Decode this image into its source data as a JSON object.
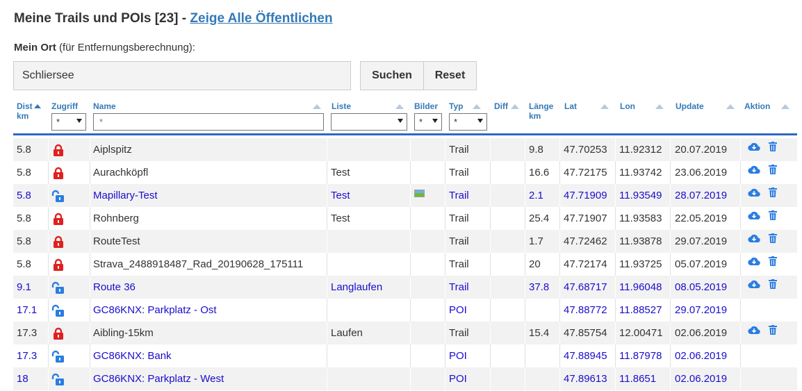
{
  "header": {
    "title": "Meine Trails und POIs [23]",
    "separator": " - ",
    "link": "Zeige Alle Öffentlichen"
  },
  "location": {
    "label": "Mein Ort",
    "hint": "(für Entfernungsberechnung):",
    "value": "Schliersee",
    "search_button": "Suchen",
    "reset_button": "Reset"
  },
  "columns": {
    "dist": "Dist",
    "dist_unit": "km",
    "access": "Zugriff",
    "name": "Name",
    "list": "Liste",
    "pics": "Bilder",
    "type": "Typ",
    "diff": "Diff",
    "length": "Länge",
    "length_unit": "km",
    "lat": "Lat",
    "lon": "Lon",
    "update": "Update",
    "action": "Aktion"
  },
  "filters": {
    "access": "*",
    "name_placeholder": "*",
    "list": "",
    "pics": "*",
    "type": "*"
  },
  "colors": {
    "link": "#337ab7",
    "public_row": "#1a0dcc",
    "lock_private": "#e02020",
    "lock_public": "#2a7de1",
    "header_rule": "#2f66c4"
  },
  "rows": [
    {
      "dist": "5.8",
      "access": "private",
      "name": "Aiplspitz",
      "list": "",
      "pics": false,
      "type": "Trail",
      "len": "9.8",
      "lat": "47.70253",
      "lon": "11.92312",
      "update": "20.07.2019",
      "actions": true
    },
    {
      "dist": "5.8",
      "access": "private",
      "name": "Aurachköpfl",
      "list": "Test",
      "pics": false,
      "type": "Trail",
      "len": "16.6",
      "lat": "47.72175",
      "lon": "11.93742",
      "update": "23.06.2019",
      "actions": true
    },
    {
      "dist": "5.8",
      "access": "public",
      "name": "Mapillary-Test",
      "list": "Test",
      "pics": true,
      "type": "Trail",
      "len": "2.1",
      "lat": "47.71909",
      "lon": "11.93549",
      "update": "28.07.2019",
      "actions": true
    },
    {
      "dist": "5.8",
      "access": "private",
      "name": "Rohnberg",
      "list": "Test",
      "pics": false,
      "type": "Trail",
      "len": "25.4",
      "lat": "47.71907",
      "lon": "11.93583",
      "update": "22.05.2019",
      "actions": true
    },
    {
      "dist": "5.8",
      "access": "private",
      "name": "RouteTest",
      "list": "",
      "pics": false,
      "type": "Trail",
      "len": "1.7",
      "lat": "47.72462",
      "lon": "11.93878",
      "update": "29.07.2019",
      "actions": true
    },
    {
      "dist": "5.8",
      "access": "private",
      "name": "Strava_2488918487_Rad_20190628_175111",
      "list": "",
      "pics": false,
      "type": "Trail",
      "len": "20",
      "lat": "47.72174",
      "lon": "11.93725",
      "update": "05.07.2019",
      "actions": true
    },
    {
      "dist": "9.1",
      "access": "public",
      "name": "Route 36",
      "list": "Langlaufen",
      "pics": false,
      "type": "Trail",
      "len": "37.8",
      "lat": "47.68717",
      "lon": "11.96048",
      "update": "08.05.2019",
      "actions": true
    },
    {
      "dist": "17.1",
      "access": "public",
      "name": "GC86KNX: Parkplatz - Ost",
      "list": "",
      "pics": false,
      "type": "POI",
      "len": "",
      "lat": "47.88772",
      "lon": "11.88527",
      "update": "29.07.2019",
      "actions": false
    },
    {
      "dist": "17.3",
      "access": "private",
      "name": "Aibling-15km",
      "list": "Laufen",
      "pics": false,
      "type": "Trail",
      "len": "15.4",
      "lat": "47.85754",
      "lon": "12.00471",
      "update": "02.06.2019",
      "actions": true
    },
    {
      "dist": "17.3",
      "access": "public",
      "name": "GC86KNX: Bank",
      "list": "",
      "pics": false,
      "type": "POI",
      "len": "",
      "lat": "47.88945",
      "lon": "11.87978",
      "update": "02.06.2019",
      "actions": false
    },
    {
      "dist": "18",
      "access": "public",
      "name": "GC86KNX: Parkplatz - West",
      "list": "",
      "pics": false,
      "type": "POI",
      "len": "",
      "lat": "47.89613",
      "lon": "11.8651",
      "update": "02.06.2019",
      "actions": false
    }
  ]
}
